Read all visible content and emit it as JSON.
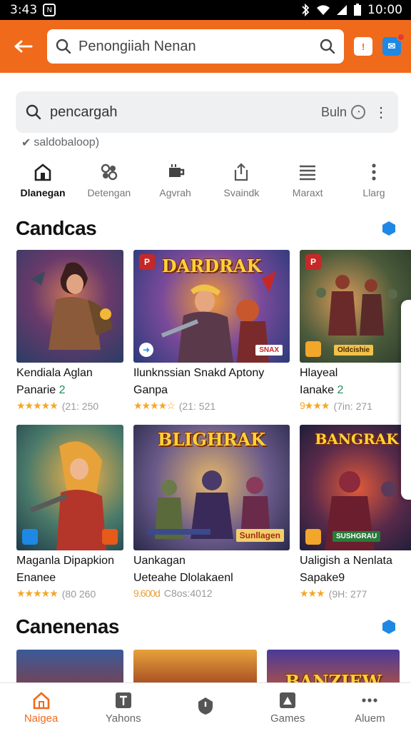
{
  "status": {
    "time": "3:43",
    "clock": "10:00"
  },
  "appbar": {
    "search_placeholder": "Penongiiah Nenan"
  },
  "search": {
    "value": "pencargah",
    "filter_label": "Buln",
    "hint": "saldobaloop)"
  },
  "categories": [
    {
      "label": "Dlanegan",
      "icon": "home-icon",
      "active": true
    },
    {
      "label": "Detengan",
      "icon": "gamepad-icon",
      "active": false
    },
    {
      "label": "Agvrah",
      "icon": "cup-icon",
      "active": false
    },
    {
      "label": "Svaindk",
      "icon": "share-icon",
      "active": false
    },
    {
      "label": "Maraxt",
      "icon": "menu-icon",
      "active": false
    },
    {
      "label": "Llarg",
      "icon": "more-vertical-icon",
      "active": false
    }
  ],
  "sections": [
    {
      "title": "Candcas",
      "rows": [
        [
          {
            "name1": "Kendiala Aglan",
            "name2": "Panarie",
            "name2_extra": "2",
            "stars": "★★★★★",
            "rating": "(21: 250",
            "badge": "",
            "logo": "",
            "tag": ""
          },
          {
            "name1": "Ilunknssian Snakd Aptony",
            "name2": "Ganpa",
            "name2_extra": "",
            "stars": "★★★★☆",
            "rating": "(21: 521",
            "badge": "P",
            "logo": "DARDRAK",
            "tag": "SNAX"
          },
          {
            "name1": "Hlayeal",
            "name2": "Ianake",
            "name2_extra": "2",
            "stars": "9★★★",
            "rating": "(7in: 271",
            "badge": "P",
            "logo": "",
            "tag": "Oldcishie"
          }
        ],
        [
          {
            "name1": "Maganla Dipapkion",
            "name2": "Enanee",
            "name2_extra": "",
            "stars": "★★★★★",
            "rating": "(80 260",
            "badge": "",
            "logo": "",
            "tag": ""
          },
          {
            "name1": "Uankagan",
            "name2": "Ueteahe Dlolakaenl",
            "name2_extra": "",
            "stars": "9.600d",
            "rating": "C8os:4012",
            "badge": "",
            "logo": "BLIGHRAK",
            "tag": "Sunllagen"
          },
          {
            "name1": "Ualigish a Nenlata",
            "name2": "Sapake9",
            "name2_extra": "",
            "stars": "★★★",
            "rating": "(9H: 277",
            "badge": "",
            "logo": "BANGRAK",
            "tag": "SUSHGRAU"
          }
        ]
      ]
    },
    {
      "title": "Canenenas",
      "rows": [
        [
          {
            "logo": ""
          },
          {
            "logo": ""
          },
          {
            "logo": "BANZIEW"
          }
        ]
      ]
    }
  ],
  "bottom_nav": [
    {
      "label": "Naigea",
      "icon": "home-icon",
      "active": true
    },
    {
      "label": "Yahons",
      "icon": "film-icon",
      "active": false
    },
    {
      "label": "",
      "icon": "shield-icon",
      "active": false
    },
    {
      "label": "Games",
      "icon": "games-icon",
      "active": false
    },
    {
      "label": "Aluem",
      "icon": "more-horizontal-icon",
      "active": false
    }
  ],
  "colors": {
    "accent": "#f06a1b",
    "blue": "#1e88e5",
    "star": "#f5a623"
  }
}
